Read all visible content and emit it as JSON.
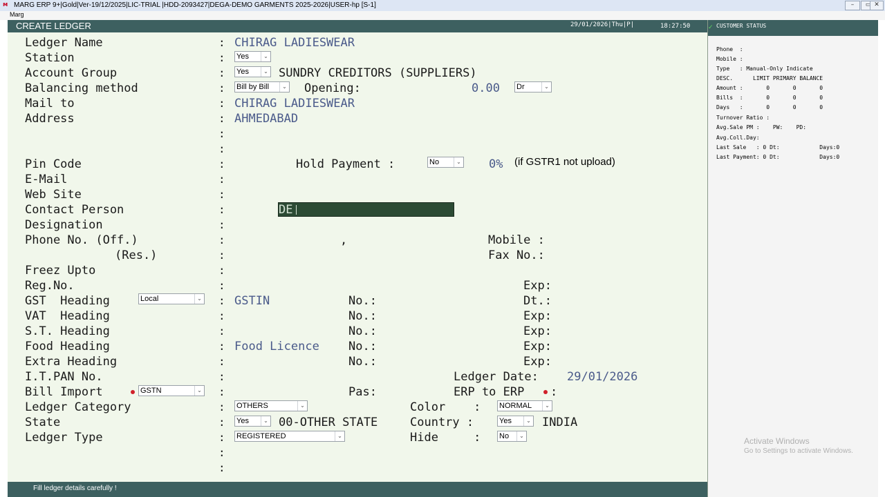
{
  "window": {
    "title": "MARG ERP 9+|Gold|Ver-19/12/2025|LIC-TRIAL |HDD-2093427|DEGA-DEMO GARMENTS 2025-2026|USER-hp [S-1]"
  },
  "menu": {
    "label": "Marg"
  },
  "header": {
    "title": "CREATE LEDGER",
    "date": "29/01/2026|Thu|P|",
    "time": "18:27:50"
  },
  "form": {
    "ledger_name": {
      "label": "Ledger Name",
      "value": "CHIRAG LADIESWEAR"
    },
    "station": {
      "label": "Station",
      "select": "Yes"
    },
    "account_group": {
      "label": "Account Group",
      "select": "Yes",
      "value": "SUNDRY CREDITORS (SUPPLIERS)"
    },
    "balancing_method": {
      "label": "Balancing method",
      "select": "Bill by Bill",
      "opening_label": "Opening:",
      "opening_value": "0.00",
      "drcr": "Dr"
    },
    "mail_to": {
      "label": "Mail to",
      "value": "CHIRAG LADIESWEAR"
    },
    "address": {
      "label": "Address",
      "value": "AHMEDABAD"
    },
    "pin_code": {
      "label": "Pin Code",
      "hold_label": "Hold Payment :",
      "hold_select": "No",
      "percent": "0%",
      "hint": "(if GSTR1 not upload)"
    },
    "email": {
      "label": "E-Mail"
    },
    "website": {
      "label": "Web Site"
    },
    "contact_person": {
      "label": "Contact Person",
      "value": "DE"
    },
    "designation": {
      "label": "Designation"
    },
    "phone_off": {
      "label": "Phone No. (Off.)",
      "comma": ",",
      "mobile_label": "Mobile :"
    },
    "phone_res": {
      "label": "(Res.)",
      "fax_label": "Fax No.:"
    },
    "freez_upto": {
      "label": "Freez Upto"
    },
    "reg_no": {
      "label": "Reg.No.",
      "exp_label": "Exp:"
    },
    "gst_heading": {
      "label": "GST  Heading",
      "select": "Local",
      "value": "GSTIN",
      "no_label": "No.:",
      "dt_label": "Dt.:"
    },
    "vat_heading": {
      "label": "VAT  Heading",
      "no_label": "No.:",
      "exp_label": "Exp:"
    },
    "st_heading": {
      "label": "S.T. Heading",
      "no_label": "No.:",
      "exp_label": "Exp:"
    },
    "food_heading": {
      "label": "Food Heading",
      "value": "Food Licence",
      "no_label": "No.:",
      "exp_label": "Exp:"
    },
    "extra_heading": {
      "label": "Extra Heading",
      "no_label": "No.:",
      "exp_label": "Exp:"
    },
    "it_pan": {
      "label": "I.T.PAN No.",
      "ledger_date_label": "Ledger Date:",
      "ledger_date": "29/01/2026"
    },
    "bill_import": {
      "label": "Bill Import",
      "select": "GSTN",
      "pas_label": "Pas:",
      "erp_label": "ERP to ERP",
      "erp_colon": ":"
    },
    "ledger_category": {
      "label": "Ledger Category",
      "select": "OTHERS",
      "color_label": "Color    :",
      "color_select": "NORMAL"
    },
    "state": {
      "label": "State",
      "select": "Yes",
      "value": "00-OTHER STATE",
      "country_label": "Country :",
      "country_select": "Yes",
      "country_value": "INDIA"
    },
    "ledger_type": {
      "label": "Ledger Type",
      "select": "REGISTERED",
      "hide_label": "Hide     :",
      "hide_select": "No"
    },
    "colon": ":"
  },
  "status_bar": {
    "text": "Fill ledger details carefully !"
  },
  "customer_status": {
    "title": "CUSTOMER STATUS",
    "lines": [
      "Phone  :",
      "Mobile :",
      "Type   : Manual-Only Indicate",
      "DESC.      LIMIT PRIMARY BALANCE",
      "Amount :       0       0       0",
      "Bills  :       0       0       0",
      "Days   :       0       0       0",
      "Turnover Ratio :",
      "Avg.Sale PM :    PW:    PD:",
      "Avg.Coll.Day:",
      "Last Sale   : 0 Dt:            Days:0",
      "Last Payment: 0 Dt:            Days:0"
    ]
  },
  "watermark": {
    "line1": "Activate Windows",
    "line2": "Go to Settings to activate Windows."
  },
  "colors": {
    "header_bg": "#3d6060",
    "form_bg": "#f1f7eb",
    "value_text": "#4a5a8a",
    "focus_box": "#2c4b34"
  }
}
